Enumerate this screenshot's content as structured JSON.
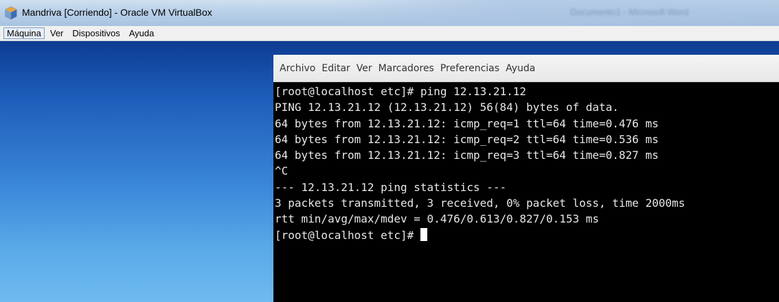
{
  "window": {
    "title": "Mandriva [Corriendo] - Oracle VM VirtualBox",
    "background_window_title": "Documento1 - Microsoft Word",
    "colors": {
      "titlebar": "#b9d0e8",
      "desktop_top": "#0d3c91",
      "desktop_bottom": "#6fbaf0",
      "terminal_bg": "#000000",
      "terminal_text": "#e8e8e8"
    }
  },
  "vbox_menu": {
    "items": [
      {
        "label": "Máquina"
      },
      {
        "label": "Ver"
      },
      {
        "label": "Dispositivos"
      },
      {
        "label": "Ayuda"
      }
    ]
  },
  "terminal": {
    "menu": [
      {
        "label": "Archivo"
      },
      {
        "label": "Editar"
      },
      {
        "label": "Ver"
      },
      {
        "label": "Marcadores"
      },
      {
        "label": "Preferencias"
      },
      {
        "label": "Ayuda"
      }
    ],
    "lines": [
      "[root@localhost etc]# ping 12.13.21.12",
      "PING 12.13.21.12 (12.13.21.12) 56(84) bytes of data.",
      "64 bytes from 12.13.21.12: icmp_req=1 ttl=64 time=0.476 ms",
      "64 bytes from 12.13.21.12: icmp_req=2 ttl=64 time=0.536 ms",
      "64 bytes from 12.13.21.12: icmp_req=3 ttl=64 time=0.827 ms",
      "^C",
      "--- 12.13.21.12 ping statistics ---",
      "3 packets transmitted, 3 received, 0% packet loss, time 2000ms",
      "rtt min/avg/max/mdev = 0.476/0.613/0.827/0.153 ms"
    ],
    "prompt": "[root@localhost etc]# "
  },
  "icons": {
    "app": "virtualbox-icon",
    "cursor": "terminal-cursor"
  }
}
